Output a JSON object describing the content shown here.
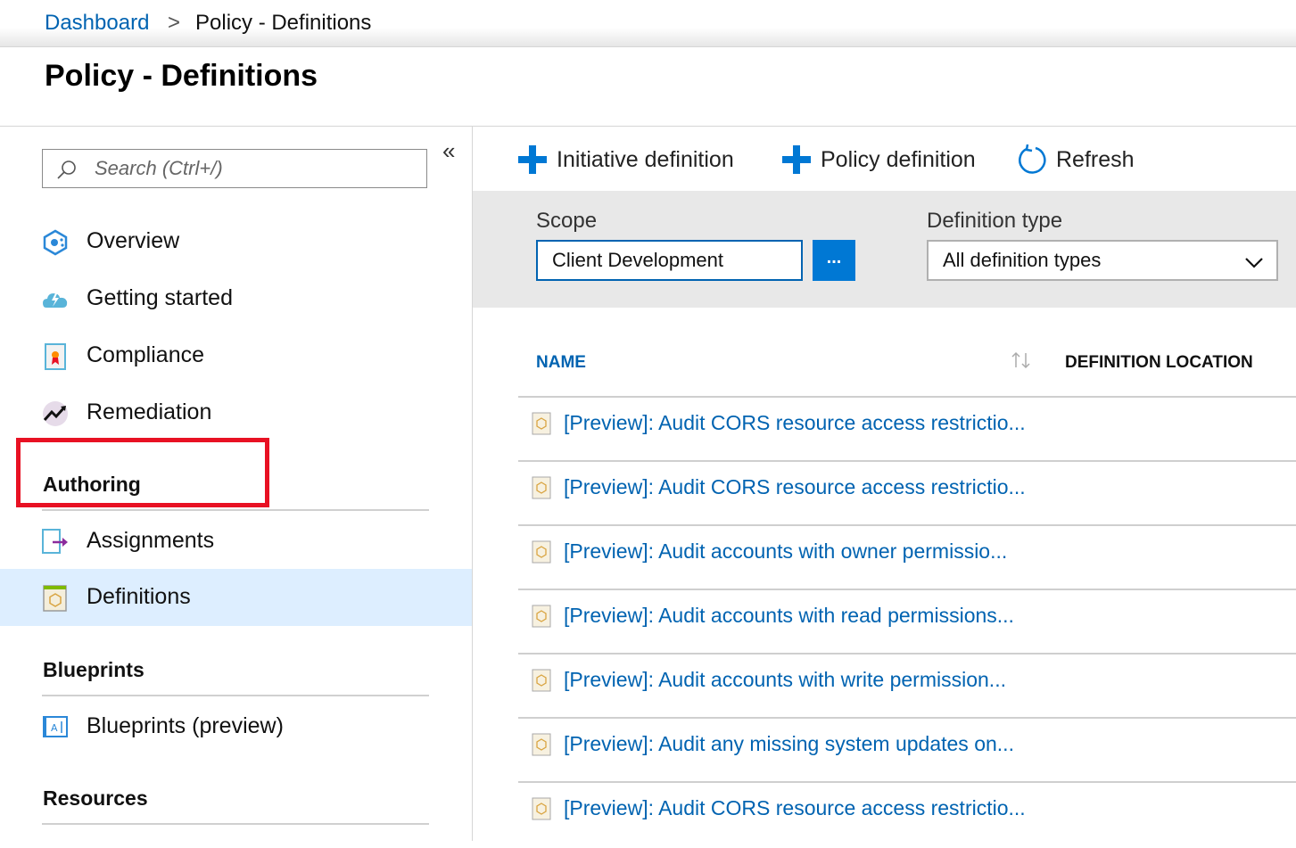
{
  "breadcrumb": {
    "home": "Dashboard",
    "separator": ">",
    "current": "Policy - Definitions"
  },
  "page": {
    "title": "Policy - Definitions"
  },
  "sidebar": {
    "search": {
      "placeholder": "Search (Ctrl+/)",
      "value": ""
    },
    "collapse": "«",
    "items": [
      {
        "label": "Overview",
        "icon": "overview-icon"
      },
      {
        "label": "Getting started",
        "icon": "cloud-lightning-icon"
      },
      {
        "label": "Compliance",
        "icon": "compliance-report-icon"
      },
      {
        "label": "Remediation",
        "icon": "trend-arrow-icon"
      }
    ],
    "sections": {
      "authoring": {
        "header": "Authoring",
        "items": [
          {
            "label": "Assignments",
            "icon": "assignment-arrow-icon"
          },
          {
            "label": "Definitions",
            "icon": "definition-document-icon",
            "selected": true
          }
        ]
      },
      "blueprints": {
        "header": "Blueprints",
        "items": [
          {
            "label": "Blueprints (preview)",
            "icon": "blueprint-icon"
          }
        ]
      },
      "resources": {
        "header": "Resources"
      }
    }
  },
  "toolbar": {
    "initiative": "Initiative definition",
    "policy": "Policy definition",
    "refresh": "Refresh"
  },
  "filters": {
    "scope_label": "Scope",
    "scope_value": "Client Development",
    "scope_more": "...",
    "type_label": "Definition type",
    "type_value": "All definition types"
  },
  "table": {
    "columns": {
      "name": "NAME",
      "location": "DEFINITION LOCATION"
    },
    "rows": [
      "[Preview]: Audit CORS resource access restrictio...",
      "[Preview]: Audit CORS resource access restrictio...",
      "[Preview]: Audit accounts with owner permissio...",
      "[Preview]: Audit accounts with read permissions...",
      "[Preview]: Audit accounts with write permission...",
      "[Preview]: Audit any missing system updates on...",
      "[Preview]: Audit CORS resource access restrictio..."
    ]
  },
  "colors": {
    "accent": "#0078d4",
    "link": "#0063b1",
    "selected_bg": "#ddeeff",
    "highlight": "#e81123"
  }
}
